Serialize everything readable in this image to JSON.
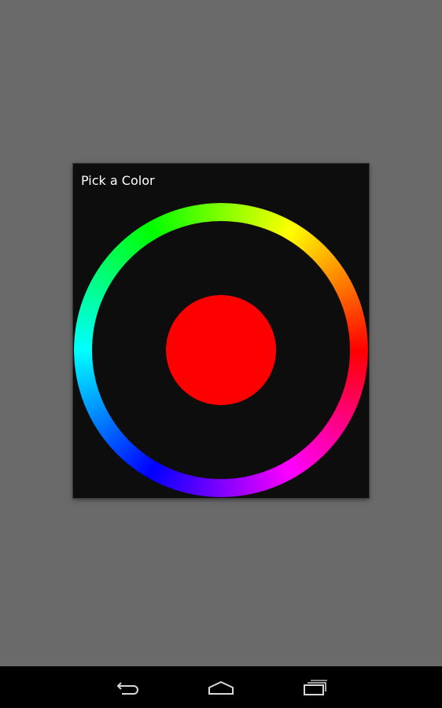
{
  "dialog": {
    "title": "Pick a Color",
    "selected_color": "#ff0000"
  },
  "colors": {
    "background": "#6a6a6a",
    "dialog_bg": "#0d0d0d",
    "navbar_bg": "#000000",
    "icon_color": "#d7d7d7"
  },
  "hue_ring": {
    "stops": [
      "#ff0000",
      "#ff00ff",
      "#0000ff",
      "#00ffff",
      "#00ff00",
      "#ffff00",
      "#ff0000"
    ]
  },
  "navigation": {
    "icons": [
      "back-icon",
      "home-icon",
      "recents-icon"
    ]
  }
}
